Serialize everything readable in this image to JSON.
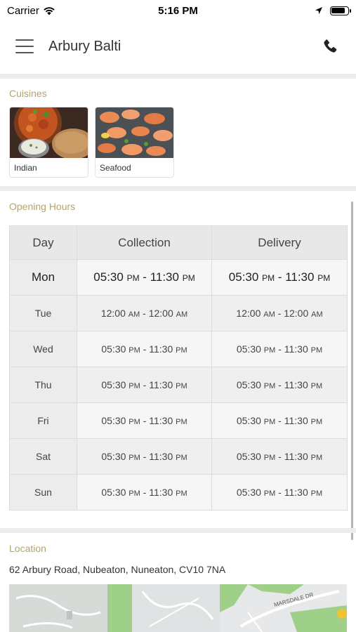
{
  "status_bar": {
    "carrier": "Carrier",
    "time": "5:16 PM",
    "battery_level": 0.85
  },
  "header": {
    "title": "Arbury Balti",
    "menu_icon": "hamburger-menu-icon",
    "phone_icon": "phone-icon"
  },
  "cuisines": {
    "label": "Cuisines",
    "items": [
      {
        "name": "Indian"
      },
      {
        "name": "Seafood"
      }
    ]
  },
  "opening_hours": {
    "label": "Opening Hours",
    "columns": [
      "Day",
      "Collection",
      "Delivery"
    ],
    "rows": [
      {
        "day": "Mon",
        "collection": {
          "start": "05:30",
          "start_ampm": "PM",
          "end": "11:30",
          "end_ampm": "PM"
        },
        "delivery": {
          "start": "05:30",
          "start_ampm": "PM",
          "end": "11:30",
          "end_ampm": "PM"
        }
      },
      {
        "day": "Tue",
        "collection": {
          "start": "12:00",
          "start_ampm": "AM",
          "end": "12:00",
          "end_ampm": "AM"
        },
        "delivery": {
          "start": "12:00",
          "start_ampm": "AM",
          "end": "12:00",
          "end_ampm": "AM"
        }
      },
      {
        "day": "Wed",
        "collection": {
          "start": "05:30",
          "start_ampm": "PM",
          "end": "11:30",
          "end_ampm": "PM"
        },
        "delivery": {
          "start": "05:30",
          "start_ampm": "PM",
          "end": "11:30",
          "end_ampm": "PM"
        }
      },
      {
        "day": "Thu",
        "collection": {
          "start": "05:30",
          "start_ampm": "PM",
          "end": "11:30",
          "end_ampm": "PM"
        },
        "delivery": {
          "start": "05:30",
          "start_ampm": "PM",
          "end": "11:30",
          "end_ampm": "PM"
        }
      },
      {
        "day": "Fri",
        "collection": {
          "start": "05:30",
          "start_ampm": "PM",
          "end": "11:30",
          "end_ampm": "PM"
        },
        "delivery": {
          "start": "05:30",
          "start_ampm": "PM",
          "end": "11:30",
          "end_ampm": "PM"
        }
      },
      {
        "day": "Sat",
        "collection": {
          "start": "05:30",
          "start_ampm": "PM",
          "end": "11:30",
          "end_ampm": "PM"
        },
        "delivery": {
          "start": "05:30",
          "start_ampm": "PM",
          "end": "11:30",
          "end_ampm": "PM"
        }
      },
      {
        "day": "Sun",
        "collection": {
          "start": "05:30",
          "start_ampm": "PM",
          "end": "11:30",
          "end_ampm": "PM"
        },
        "delivery": {
          "start": "05:30",
          "start_ampm": "PM",
          "end": "11:30",
          "end_ampm": "PM"
        }
      }
    ]
  },
  "location": {
    "label": "Location",
    "address": "62 Arbury Road, Nubeaton, Nuneaton, CV10 7NA",
    "map_street_label": "MARSDALE DR"
  },
  "colors": {
    "section_label": "#b3a36e",
    "divider": "#ececec",
    "table_header": "#e8e8e8"
  }
}
